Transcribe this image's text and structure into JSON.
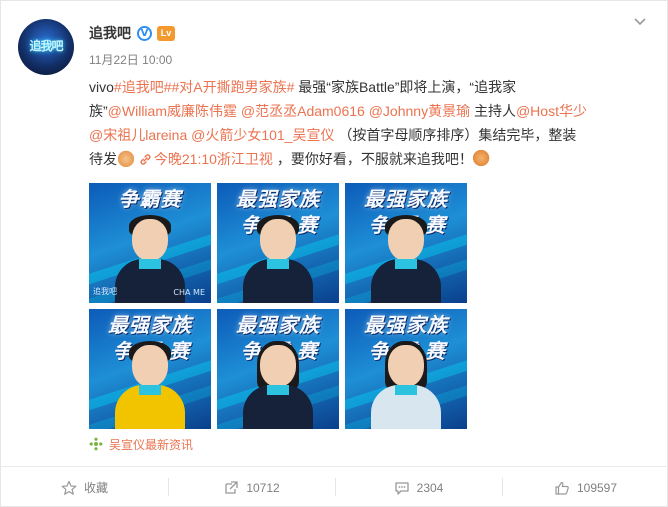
{
  "post": {
    "username": "追我吧",
    "verified_badge": "V",
    "level_badge": "Lv",
    "timestamp": "11月22日 10:00",
    "avatar_text": "追我吧",
    "content": {
      "line1_prefix": "vivo",
      "topic1": "#追我吧#",
      "topic2": "#对A开撕跑男家族#",
      "line1_mid": " 最强“家族Battle”即将上演，“追我家",
      "line2_start": "族”",
      "mention1": "@William威廉陈伟霆",
      "mention2": "@范丞丞Adam0616",
      "mention3": "@Johnny黄景瑜",
      "host_label": " 主持人",
      "mention4": "@Host华少",
      "mention5": "@宋祖儿lareina",
      "mention6": "@火箭少女101_吴宣仪",
      "line3_tail": " （按首字母顺序排序）集结完毕，整装",
      "line4_start": "待发",
      "link_text": "今晚21:10浙江卫视",
      "line4_tail": " ，要你好看，不服就来追我吧！"
    },
    "images": [
      {
        "title": "争霸赛",
        "sub": "",
        "caption_left": "追我吧",
        "caption_right": "CHA ME",
        "style": "dark",
        "hair": "short"
      },
      {
        "title": "最强家族",
        "sub": "争霸赛",
        "caption_left": "",
        "caption_right": "",
        "style": "dark",
        "hair": "short"
      },
      {
        "title": "最强家族",
        "sub": "争霸赛",
        "caption_left": "",
        "caption_right": "",
        "style": "dark",
        "hair": "short"
      },
      {
        "title": "最强家族",
        "sub": "争霸赛",
        "caption_left": "",
        "caption_right": "",
        "style": "yellow",
        "hair": "short"
      },
      {
        "title": "最强家族",
        "sub": "争霸赛",
        "caption_left": "",
        "caption_right": "",
        "style": "dark",
        "hair": "long"
      },
      {
        "title": "最强家族",
        "sub": "争霸赛",
        "caption_left": "",
        "caption_right": "",
        "style": "light",
        "hair": "long"
      }
    ],
    "source_label": "吴宣仪最新资讯"
  },
  "actions": {
    "favorite": "收藏",
    "repost": "10712",
    "comment": "2304",
    "like": "109597"
  },
  "colors": {
    "link": "#eb7350",
    "verified": "#2e8ef0",
    "level": "#f29a2e"
  },
  "icons": {
    "menu": "chevron-down-icon",
    "favorite": "star-icon",
    "repost": "repost-icon",
    "comment": "comment-icon",
    "like": "thumbs-up-icon",
    "link": "link-icon",
    "source": "sparkle-icon"
  }
}
